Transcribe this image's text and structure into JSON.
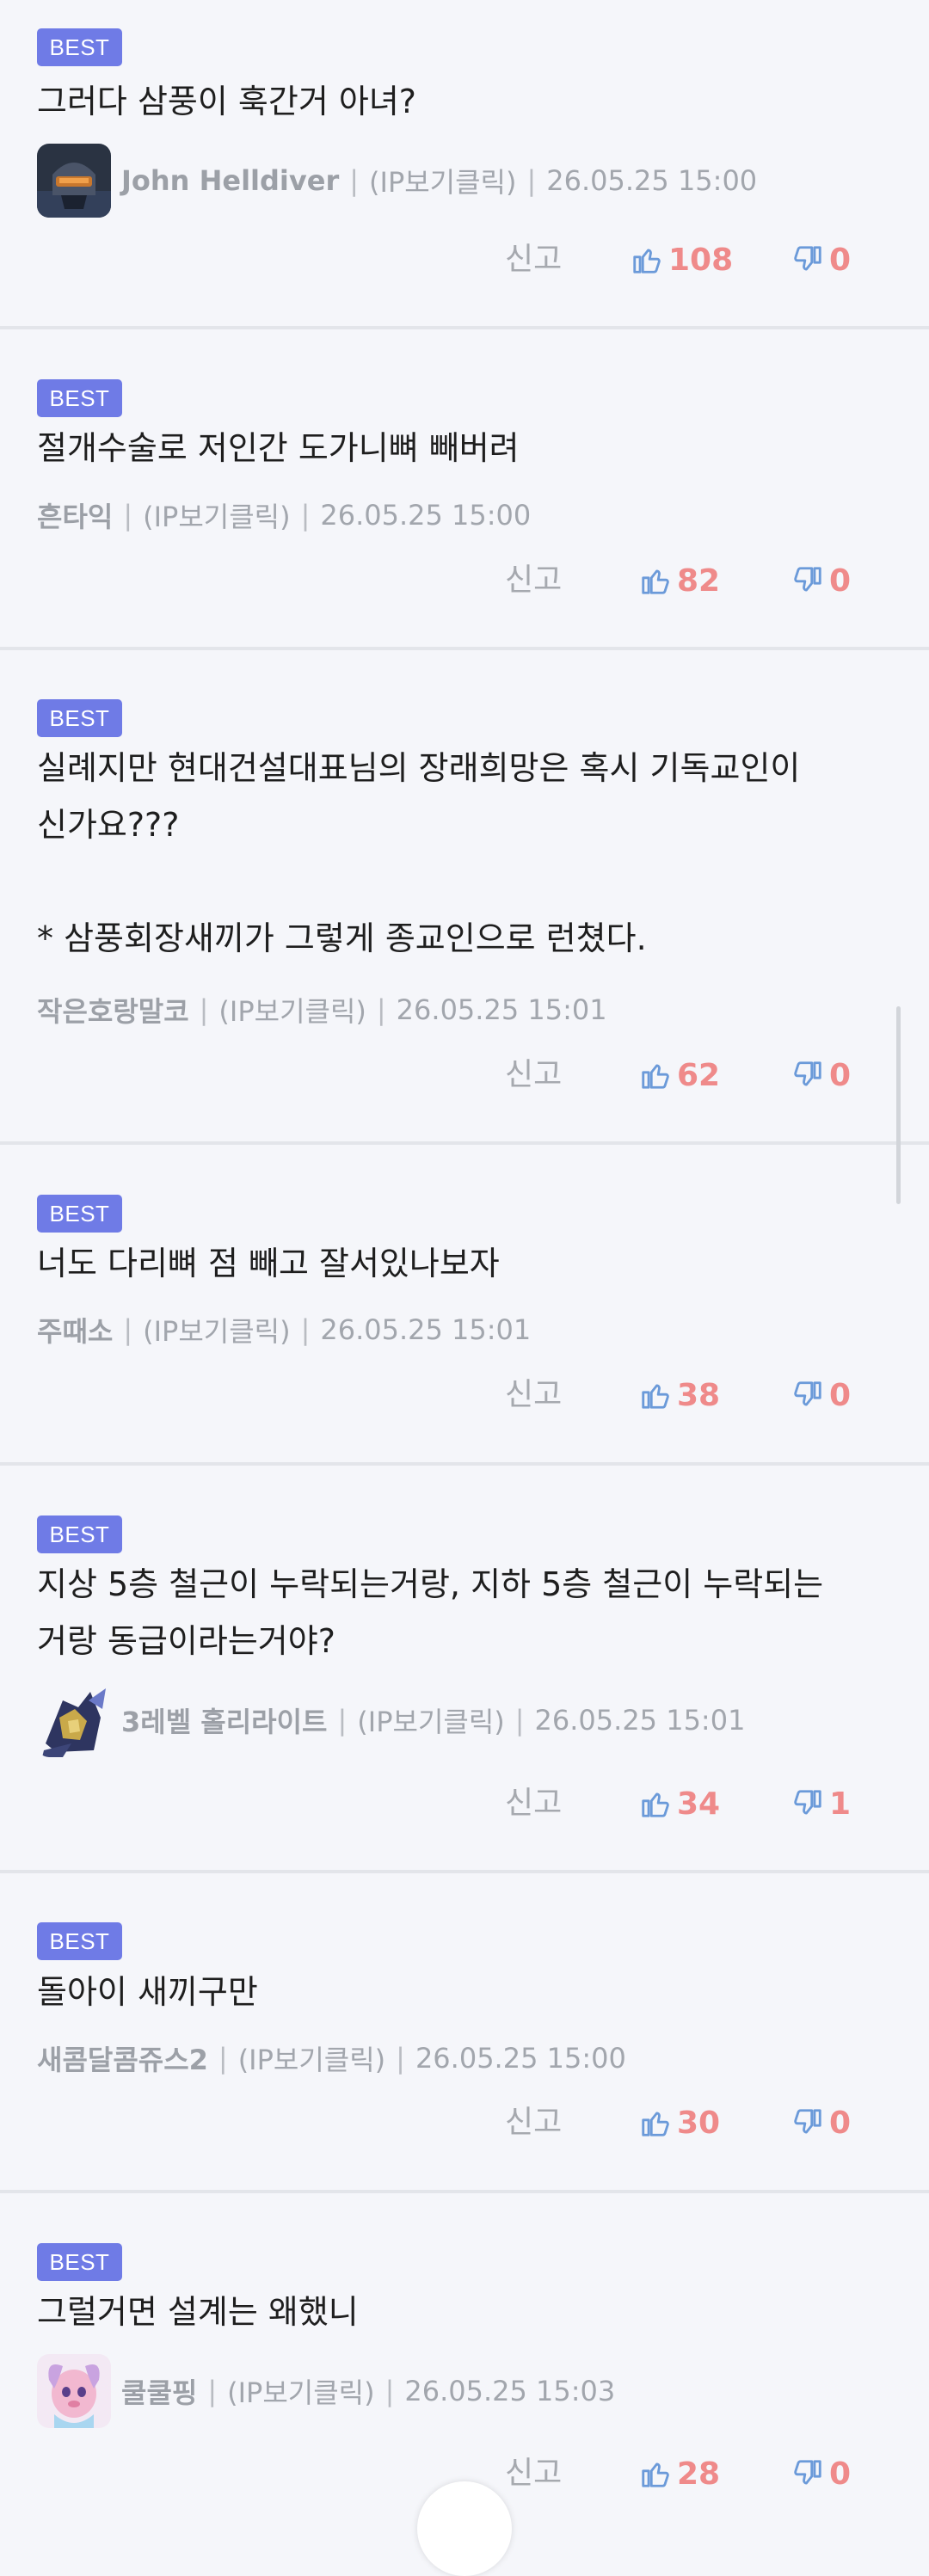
{
  "badge_label": "BEST",
  "report_label": "신고",
  "ip_label": "(IP보기클릭)",
  "separator": "|",
  "comments": [
    {
      "text": "그러다 삼풍이 훅간거 아녀?",
      "author": "John Helldiver",
      "date": "26.05.25 15:00",
      "likes": "108",
      "dislikes": "0",
      "avatar": "soldier-helmet-avatar"
    },
    {
      "text": "절개수술로 저인간 도가니뼈 빼버려",
      "author": "흔타익",
      "date": "26.05.25 15:00",
      "likes": "82",
      "dislikes": "0",
      "avatar": ""
    },
    {
      "text": "실례지만 현대건설대표님의 장래희망은 혹시 기독교인이\n신가요???\n\n* 삼풍회장새끼가 그렇게 종교인으로 런쳤다.",
      "author": "작은호랑말코",
      "date": "26.05.25 15:01",
      "likes": "62",
      "dislikes": "0",
      "avatar": ""
    },
    {
      "text": "너도 다리뼈 점 빼고 잘서있나보자",
      "author": "주때소",
      "date": "26.05.25 15:01",
      "likes": "38",
      "dislikes": "0",
      "avatar": ""
    },
    {
      "text": "지상 5층 철근이 누락되는거랑, 지하 5층 철근이 누락되는\n거랑 동급이라는거야?",
      "author": "3레벨 홀리라이트",
      "date": "26.05.25 15:01",
      "likes": "34",
      "dislikes": "1",
      "avatar": "armored-knight-avatar"
    },
    {
      "text": "돌아이 새끼구만",
      "author": "새콤달콤쥬스2",
      "date": "26.05.25 15:00",
      "likes": "30",
      "dislikes": "0",
      "avatar": ""
    },
    {
      "text": "그럴거면 설계는 왜했니",
      "author": "쿨쿨핑",
      "date": "26.05.25 15:03",
      "likes": "28",
      "dislikes": "0",
      "avatar": "pink-character-avatar"
    }
  ]
}
